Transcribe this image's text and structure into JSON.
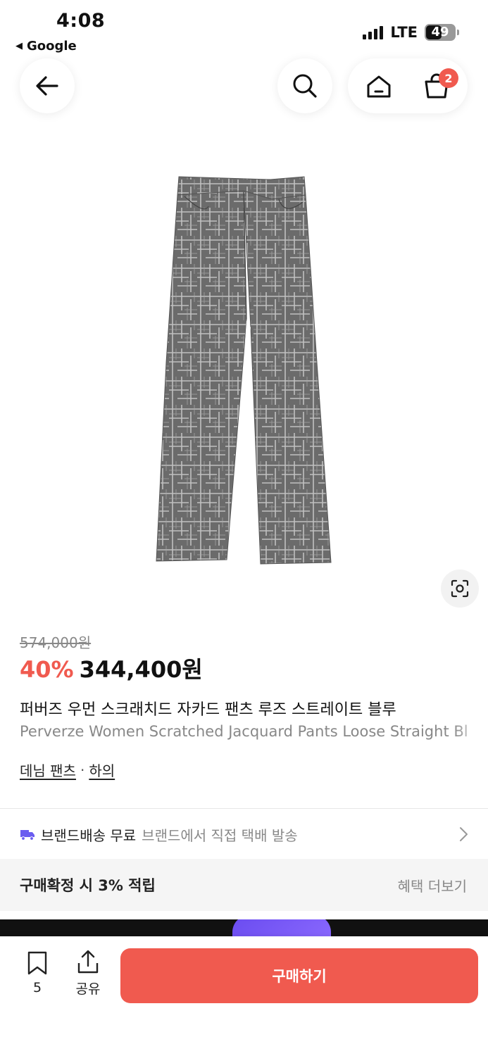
{
  "status_bar": {
    "time": "4:08",
    "back_app": "Google",
    "network": "LTE",
    "battery": "49"
  },
  "nav": {
    "back_icon": "arrow-left-icon",
    "search_icon": "search-icon",
    "home_icon": "home-icon",
    "cart_icon": "shopping-bag-icon",
    "cart_badge": "2"
  },
  "product": {
    "image_icon": "jeans-pants-image",
    "original_price": "574,000원",
    "discount": "40%",
    "price": "344,400원",
    "title_ko": "퍼버즈 우먼 스크래치드 자카드 팬츠 루즈 스트레이트 블루",
    "title_en": "Perverze Women Scratched Jacquard Pants Loose Straight Bl",
    "categories": [
      "데님 팬츠",
      "하의"
    ],
    "category_separator": "·"
  },
  "shipping": {
    "icon": "truck-icon",
    "label": "브랜드배송 무료",
    "description": "브랜드에서 직접 택배 발송"
  },
  "benefit": {
    "label": "구매확정 시 3% 적립",
    "more": "혜택 더보기"
  },
  "bottom_bar": {
    "bookmark_count": "5",
    "share_label": "공유",
    "buy_label": "구매하기"
  },
  "colors": {
    "accent": "#f05a4f",
    "shipping_icon": "#6a5cf0",
    "muted_text": "#888888"
  }
}
